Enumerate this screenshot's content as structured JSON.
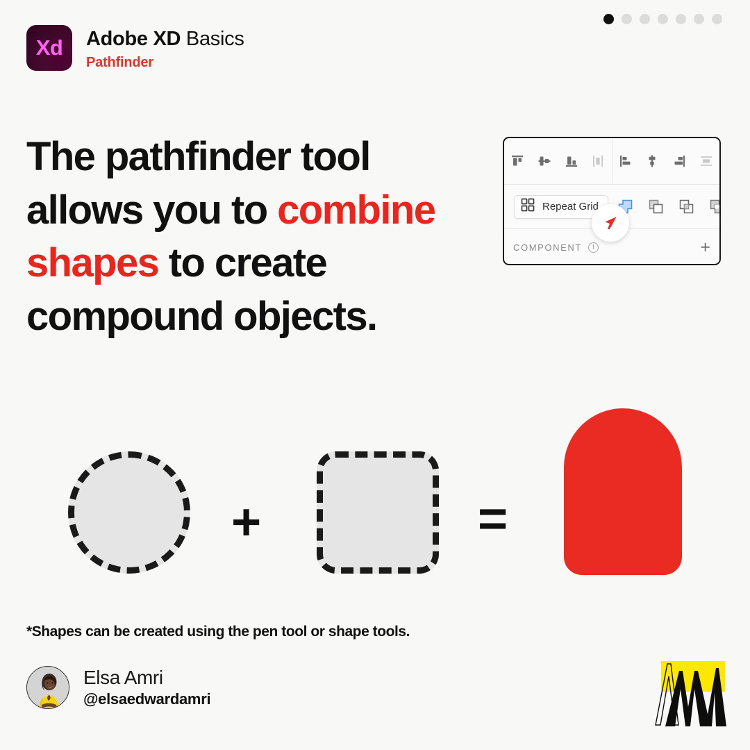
{
  "brand": {
    "app_badge_text": "Xd",
    "title_strong": "Adobe XD",
    "title_light": " Basics",
    "subtitle": "Pathfinder",
    "accent_red": "#e9251d",
    "badge_purple": "#2e0420",
    "badge_pink": "#ff61f6",
    "background": "#f8f8f6"
  },
  "pagination": {
    "total": 7,
    "active_index": 1
  },
  "headline": {
    "part1": "The pathfinder tool allows you to ",
    "highlight": "combine shapes",
    "part2": " to create compound objects."
  },
  "panel": {
    "align_vertical": [
      {
        "name": "align-top-icon",
        "label": "Align top",
        "enabled": true
      },
      {
        "name": "align-middle-vertical-icon",
        "label": "Align middle vertically",
        "enabled": true
      },
      {
        "name": "align-bottom-icon",
        "label": "Align bottom",
        "enabled": true
      },
      {
        "name": "distribute-vertical-icon",
        "label": "Distribute vertically",
        "enabled": false
      }
    ],
    "align_horizontal": [
      {
        "name": "align-left-icon",
        "label": "Align left",
        "enabled": true
      },
      {
        "name": "align-center-horizontal-icon",
        "label": "Align center horizontally",
        "enabled": true
      },
      {
        "name": "align-right-icon",
        "label": "Align right",
        "enabled": true
      },
      {
        "name": "distribute-horizontal-icon",
        "label": "Distribute horizontally",
        "enabled": false
      }
    ],
    "repeat_grid_label": "Repeat Grid",
    "pathfinder_ops": [
      {
        "name": "pathfinder-add-icon",
        "label": "Add",
        "active": true
      },
      {
        "name": "pathfinder-subtract-icon",
        "label": "Subtract",
        "active": false
      },
      {
        "name": "pathfinder-intersect-icon",
        "label": "Intersect",
        "active": false
      },
      {
        "name": "pathfinder-exclude-overlap-icon",
        "label": "Exclude Overlap",
        "active": false
      }
    ],
    "active_op_color": "#5b9fe0",
    "component_label": "COMPONENT",
    "info_glyph": "i",
    "add_component_glyph": "+",
    "cursor_badge_color": "#ea2b23"
  },
  "shapes_demo": {
    "operand_a": "circle",
    "operand_a_fill": "#e5e5e5",
    "operator_1": "+",
    "operand_b": "rounded-square",
    "operand_b_fill": "#e5e5e5",
    "operator_2": "=",
    "result": "compound-tombstone",
    "result_fill": "#ea2b23",
    "stroke_style": "dashed",
    "stroke_color": "#1a1a1a"
  },
  "footnote": "*Shapes can be created using the pen tool or shape tools.",
  "author": {
    "name": "Elsa Amri",
    "handle": "@elsaedwardamri",
    "avatar_alt": "avatar-photo"
  },
  "brand_mark": {
    "name": "am-monogram-logo",
    "highlight_color": "#ffe800",
    "ink_color": "#0d0d0d"
  }
}
